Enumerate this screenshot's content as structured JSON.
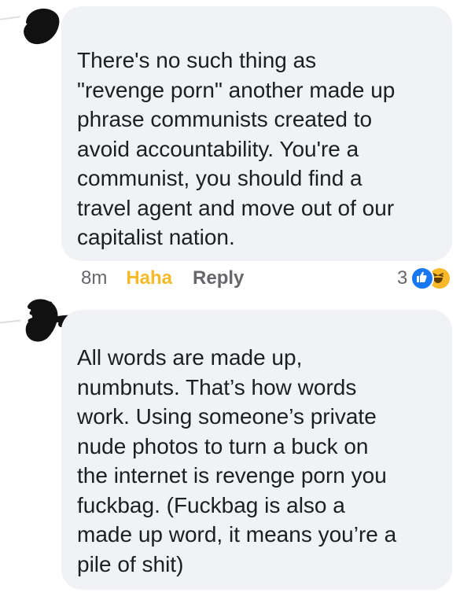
{
  "comments": [
    {
      "text": "There's no such thing as\n\"revenge porn\" another made up\nphrase communists created to\navoid accountability. You're a\ncommunist, you should find a\ntravel agent and move out of our\ncapitalist nation.",
      "verified": true,
      "meta": {
        "time": "8m",
        "reaction_label": "Haha",
        "reply_label": "Reply"
      },
      "reactions": {
        "count": "3",
        "icons": [
          "like-icon",
          "haha-icon"
        ]
      }
    },
    {
      "text": "All words are made up,\nnumbnuts. That’s how words\nwork. Using someone’s private\nnude photos to turn a buck on\nthe internet is revenge porn you\nfuckbag. (Fuckbag is also a\nmade up word, it means you’re a\npile of shit)"
    }
  ],
  "colors": {
    "bubble": "#f0f2f5",
    "text": "#1c1e21",
    "meta": "#65676b",
    "haha": "#f7b928",
    "like": "#1877f2"
  }
}
